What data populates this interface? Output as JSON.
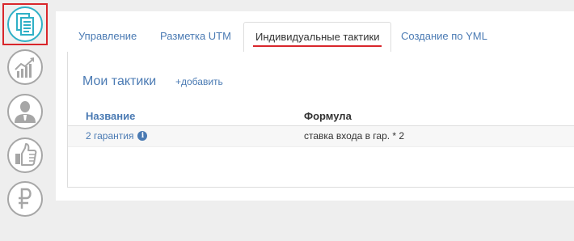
{
  "sidebar": {
    "items": [
      {
        "name": "documents",
        "icon": "documents-icon",
        "active": true
      },
      {
        "name": "analytics",
        "icon": "growth-chart-icon",
        "active": false
      },
      {
        "name": "profile",
        "icon": "user-icon",
        "active": false
      },
      {
        "name": "likes",
        "icon": "thumbs-up-icon",
        "active": false
      },
      {
        "name": "payments",
        "icon": "ruble-icon",
        "active": false
      }
    ]
  },
  "tabs": [
    {
      "label": "Управление",
      "active": false
    },
    {
      "label": "Разметка UTM",
      "active": false
    },
    {
      "label": "Индивидуальные тактики",
      "active": true
    },
    {
      "label": "Создание по YML",
      "active": false
    }
  ],
  "panel": {
    "title": "Мои тактики",
    "add_label": "+добавить",
    "columns": {
      "name": "Название",
      "formula": "Формула"
    },
    "rows": [
      {
        "name": "2 гарантия",
        "info": "i",
        "formula": "ставка входа в гар. * 2"
      }
    ]
  },
  "colors": {
    "link": "#4a7ab3",
    "accent_red": "#d9262b",
    "active_icon": "#2fb0c6",
    "inactive_icon": "#a6a6a6"
  }
}
